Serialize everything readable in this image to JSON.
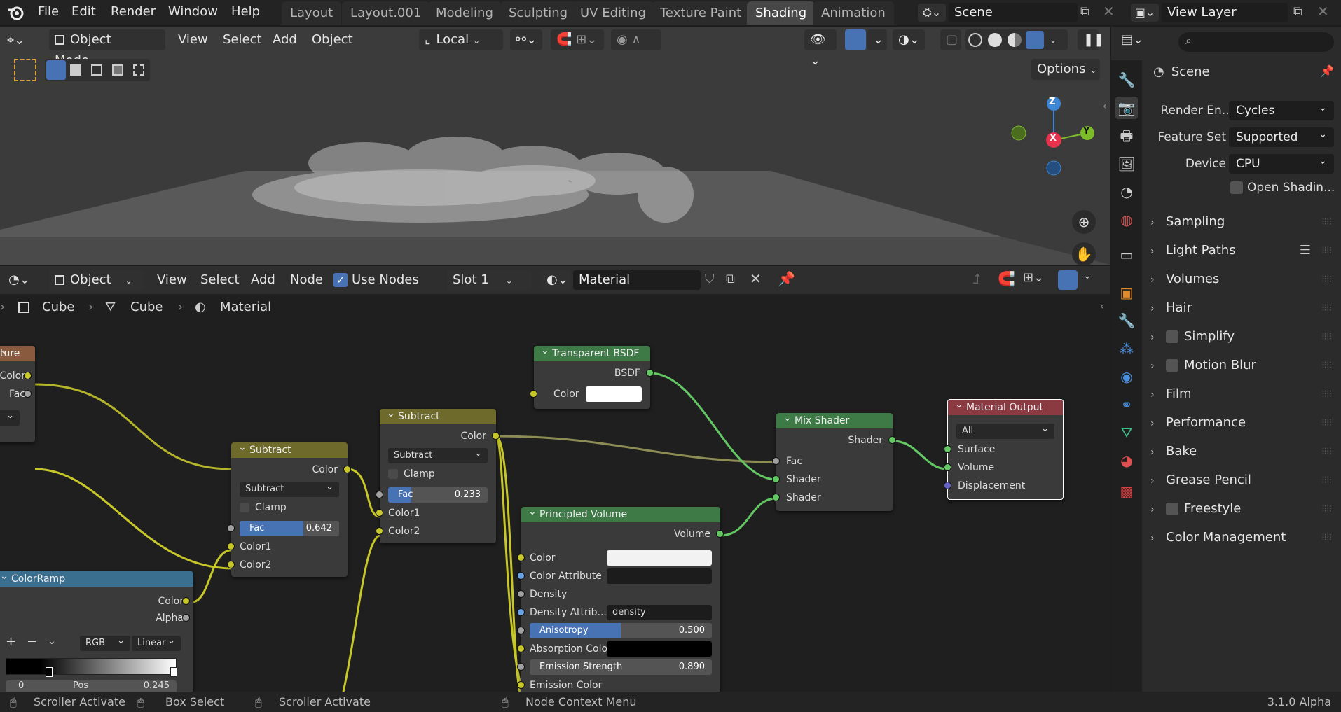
{
  "topbar": {
    "menus": [
      "File",
      "Edit",
      "Render",
      "Window",
      "Help"
    ],
    "workspaces": [
      "Layout",
      "Layout.001",
      "Modeling",
      "Sculpting",
      "UV Editing",
      "Texture Paint",
      "Shading",
      "Animation"
    ],
    "active_workspace": "Shading",
    "scene_name": "Scene",
    "view_layer": "View Layer"
  },
  "viewport": {
    "mode": "Object Mode",
    "menus": [
      "View",
      "Select",
      "Add",
      "Object"
    ],
    "transform_orientation": "Local",
    "options_label": "Options",
    "gizmo_axes": [
      "Z",
      "X",
      "Y"
    ]
  },
  "node_editor": {
    "object_label": "Object",
    "menus": [
      "View",
      "Select",
      "Add",
      "Node"
    ],
    "use_nodes_label": "Use Nodes",
    "use_nodes_checked": true,
    "slot": "Slot 1",
    "material_name": "Material",
    "breadcrumb": [
      "Cube",
      "Cube",
      "Material"
    ],
    "nodes": {
      "texture_partial": {
        "title": "ture",
        "outputs": [
          "Color",
          "Fac"
        ]
      },
      "colorramp": {
        "title": "ColorRamp",
        "outputs": [
          "Color",
          "Alpha"
        ],
        "color_mode": "RGB",
        "interpolation": "Linear",
        "pos_label": "Pos",
        "pos_value": "0.245",
        "index": "0"
      },
      "subtract1": {
        "title": "Subtract",
        "output": "Color",
        "operation": "Subtract",
        "clamp_label": "Clamp",
        "fac_label": "Fac",
        "fac_value": "0.642",
        "fac": 0.642,
        "inputs": [
          "Color1",
          "Color2"
        ]
      },
      "subtract2": {
        "title": "Subtract",
        "output": "Color",
        "operation": "Subtract",
        "clamp_label": "Clamp",
        "fac_label": "Fac",
        "fac_value": "0.233",
        "fac": 0.233,
        "inputs": [
          "Color1",
          "Color2"
        ]
      },
      "transparent": {
        "title": "Transparent BSDF",
        "output": "BSDF",
        "input": "Color"
      },
      "principled_volume": {
        "title": "Principled Volume",
        "output": "Volume",
        "color_label": "Color",
        "color_attr_label": "Color Attribute",
        "density_label": "Density",
        "density_attr_label": "Density Attrib...",
        "density_attr_value": "density",
        "anisotropy_label": "Anisotropy",
        "anisotropy_value": "0.500",
        "anisotropy": 0.5,
        "absorption_label": "Absorption Color",
        "emission_strength_label": "Emission Strength",
        "emission_strength_value": "0.890",
        "emission_color_label": "Emission Color"
      },
      "mix_shader": {
        "title": "Mix Shader",
        "output": "Shader",
        "inputs": [
          "Fac",
          "Shader",
          "Shader"
        ]
      },
      "material_output": {
        "title": "Material Output",
        "target": "All",
        "inputs": [
          "Surface",
          "Volume",
          "Displacement"
        ]
      }
    }
  },
  "properties": {
    "title": "Scene",
    "render_engine_label": "Render En...",
    "render_engine": "Cycles",
    "feature_set_label": "Feature Set",
    "feature_set": "Supported",
    "device_label": "Device",
    "device": "CPU",
    "open_shading_label": "Open Shadin...",
    "panels": [
      "Sampling",
      "Light Paths",
      "Volumes",
      "Hair",
      "Simplify",
      "Motion Blur",
      "Film",
      "Performance",
      "Bake",
      "Grease Pencil",
      "Freestyle",
      "Color Management"
    ]
  },
  "statusbar": {
    "items": [
      "Scroller Activate",
      "Box Select",
      "Scroller Activate",
      "Node Context Menu"
    ],
    "version": "3.1.0 Alpha"
  },
  "colors": {
    "active_tab": "#474747",
    "accent_blue": "#4772b3",
    "wire_yellow": "#c7c729",
    "wire_green": "#63c763"
  }
}
